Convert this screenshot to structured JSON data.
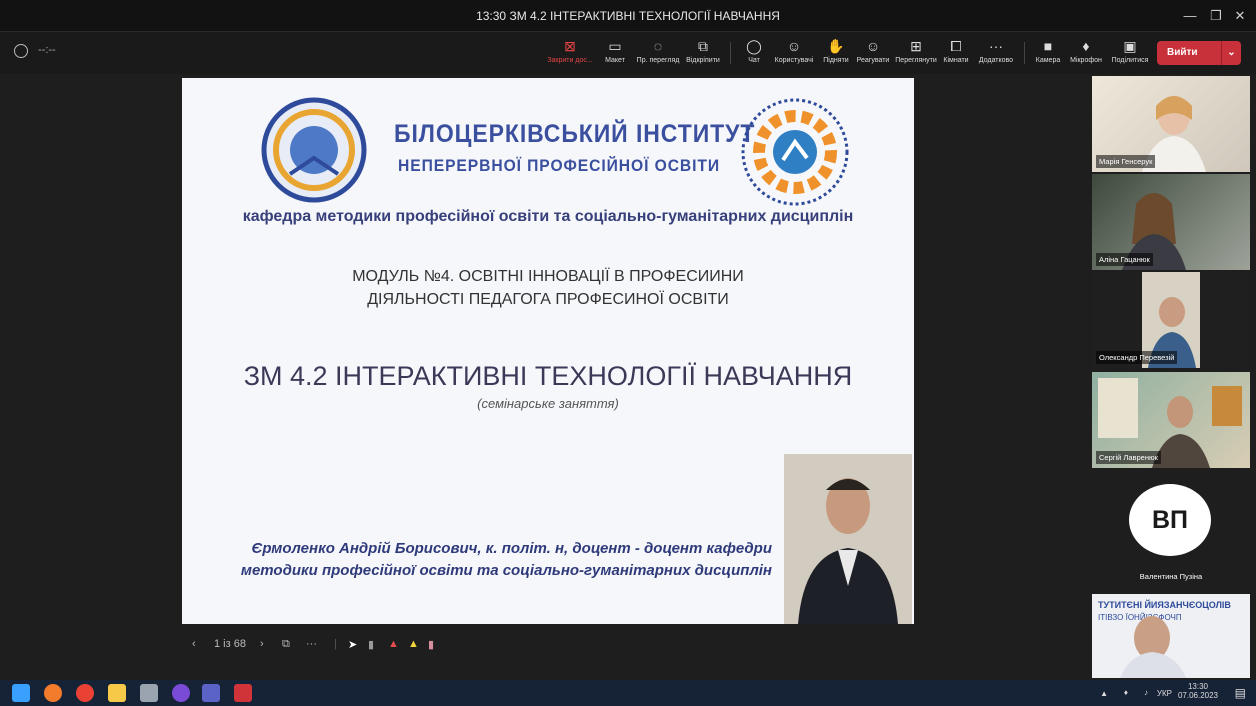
{
  "window": {
    "title": "13:30 ЗМ 4.2 ІНТЕРАКТИВНІ ТЕХНОЛОГІЇ НАВЧАННЯ",
    "timer": "--:--"
  },
  "toolbar": {
    "stop_share": "Закрити дос...",
    "layout": "Макет",
    "preview": "Пр. перегляд",
    "open": "Відкріпити",
    "chat": "Чат",
    "users": "Користувачі",
    "raise": "Підняти",
    "react": "Реагувати",
    "view": "Переглянути",
    "rooms": "Кімнати",
    "more": "Додатково",
    "camera": "Камера",
    "mic": "Мікрофон",
    "share": "Поділитися",
    "leave": "Вийти"
  },
  "slide": {
    "institute_line1": "БІЛОЦЕРКІВСЬКИЙ ІНСТИТУТ",
    "institute_line2": "НЕПЕРЕРВНОЇ ПРОФЕСІЙНОЇ ОСВІТИ",
    "department": "кафедра методики професійної освіти та соціально-гуманітарних дисциплін",
    "module_line1": "МОДУЛЬ №4. ОСВІТНІ ІННОВАЦІЇ В ПРОФЕСИИНИ",
    "module_line2": "ДІЯЛЬНОСТІ ПЕДАГОГА ПРОФЕСИНОЇ ОСВІТИ",
    "topic": "ЗМ 4.2 ІНТЕРАКТИВНІ ТЕХНОЛОГІЇ НАВЧАННЯ",
    "subtopic": "(семінарське заняття)",
    "author_line1": "Єрмоленко Андрій Борисович, к. політ. н, доцент - доцент кафедри",
    "author_line2": "методики професійної освіти та соціально-гуманітарних дисциплін"
  },
  "slide_controls": {
    "page": "1 із 68"
  },
  "participants": [
    {
      "name": "Марія Генсерук"
    },
    {
      "name": "Аліна Гацанюк"
    },
    {
      "name": "Олександр Перевезій"
    },
    {
      "name": "Сергій Лавренюк"
    },
    {
      "name": "Валентина Пузіна",
      "initials": "ВП"
    }
  ],
  "taskbar": {
    "lang": "УКР",
    "time": "13:30",
    "date": "07.06.2023"
  },
  "colors": {
    "leave": "#c8303a",
    "slide_text_blue": "#3a4f9e",
    "taskbar": "#162236"
  }
}
